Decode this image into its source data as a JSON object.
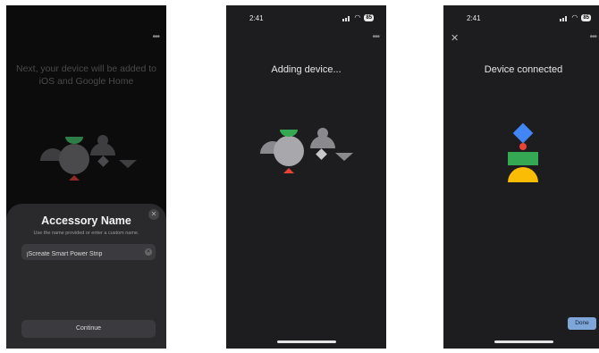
{
  "screens": [
    {
      "title_line1": "Next, your device will be added to",
      "title_line2": "iOS and Google Home",
      "menu_icon": "more-icon",
      "sheet": {
        "title": "Accessory Name",
        "subtitle": "Use the name provided or enter a custom name.",
        "name_value": "jScreate Smart Power Strip",
        "continue_label": "Continue"
      }
    },
    {
      "status": {
        "time": "2:41",
        "battery": "85"
      },
      "title": "Adding device..."
    },
    {
      "status": {
        "time": "2:41",
        "battery": "85"
      },
      "title": "Device connected",
      "done_label": "Done"
    }
  ],
  "colors": {
    "green": "#34a853",
    "red": "#ea4335",
    "blue": "#4285f4",
    "yellow": "#fbbc05",
    "shape_gray": "#8a8a8e",
    "accent_button": "#7fa6d8"
  }
}
